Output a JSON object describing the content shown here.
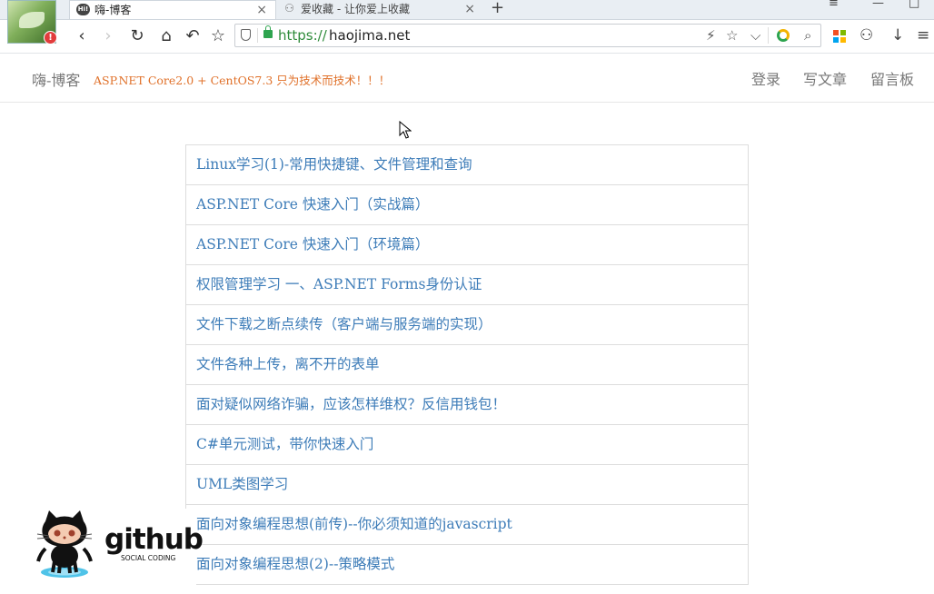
{
  "browser": {
    "tabs": [
      {
        "favicon": "Hi!",
        "title": "嗨-博客",
        "active": true
      },
      {
        "favicon": "user-icon",
        "title": "爱收藏 - 让你爱上收藏",
        "active": false
      }
    ],
    "new_tab_label": "+",
    "window_controls": [
      "≡",
      "—",
      "□"
    ],
    "address": {
      "scheme": "https://",
      "host": "haojima.net"
    },
    "nav": {
      "back": "‹",
      "forward": "›",
      "reload": "↻",
      "home": "⌂",
      "undo": "↶",
      "favorite": "☆"
    },
    "address_icons": {
      "lightning": "⚡",
      "star": "☆",
      "dropdown": "⌵",
      "search": "⌕"
    },
    "right_icons": {
      "user": "⚇",
      "download": "↓",
      "menu": "≡"
    },
    "notification_badge": "!"
  },
  "header": {
    "brand": "嗨-博客",
    "slogan": "ASP.NET Core2.0 + CentOS7.3 只为技术而技术！！！",
    "nav": {
      "login": "登录",
      "write": "写文章",
      "guestbook": "留言板"
    }
  },
  "articles": [
    "Linux学习(1)-常用快捷键、文件管理和查询",
    "ASP.NET Core 快速入门（实战篇）",
    "ASP.NET Core 快速入门（环境篇）",
    "权限管理学习 一、ASP.NET Forms身份认证",
    "文件下载之断点续传（客户端与服务端的实现）",
    "文件各种上传，离不开的表单",
    "面对疑似网络诈骗，应该怎样维权？反信用钱包！",
    "C#单元测试，带你快速入门",
    "UML类图学习",
    "面向对象编程思想(前传)--你必须知道的javascript",
    "面向对象编程思想(2)--策略模式"
  ],
  "github": {
    "word": "github",
    "sub": "SOCIAL CODING"
  },
  "colors": {
    "link": "#3d7cb8",
    "slogan": "#e0712a",
    "secure": "#2e8b3a"
  }
}
